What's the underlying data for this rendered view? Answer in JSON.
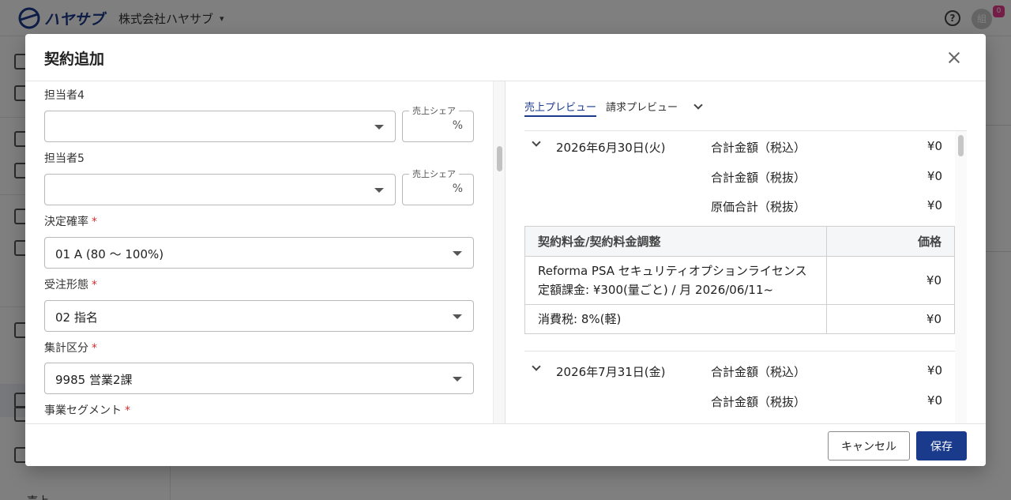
{
  "app": {
    "logo_text": "ハヤサブ",
    "company_name": "株式会社ハヤサブ",
    "avatar_initial": "組",
    "avatar_badge": "0",
    "sidebar_bottom_label": "売上"
  },
  "modal": {
    "title": "契約追加",
    "fields": {
      "staff4": {
        "label": "担当者4",
        "value": "",
        "share_legend": "売上シェア",
        "share_unit": "%"
      },
      "staff5": {
        "label": "担当者5",
        "value": "",
        "share_legend": "売上シェア",
        "share_unit": "%"
      },
      "probability": {
        "label": "決定確率",
        "required_mark": "*",
        "value": "01 A (80 〜 100%)"
      },
      "order_type": {
        "label": "受注形態",
        "required_mark": "*",
        "value": "02 指名"
      },
      "aggregation": {
        "label": "集計区分",
        "required_mark": "*",
        "value": "9985 営業2課"
      },
      "segment": {
        "label": "事業セグメント",
        "required_mark": "*"
      }
    },
    "preview": {
      "tabs": [
        "売上プレビュー",
        "請求プレビュー"
      ],
      "active_tab": 0,
      "months": [
        {
          "date": "2026年6月30日(火)",
          "totals": [
            {
              "label": "合計金額（税込）",
              "value": "¥0"
            },
            {
              "label": "合計金額（税抜）",
              "value": "¥0"
            },
            {
              "label": "原価合計（税抜）",
              "value": "¥0"
            }
          ],
          "table": {
            "headers": [
              "契約料金/契約料金調整",
              "価格"
            ],
            "rows": [
              {
                "item": "Reforma PSA セキュリティオプションライセンス 定額課金: ¥300(量ごと) / 月 2026/06/11~",
                "price": "¥0"
              },
              {
                "item": "消費税: 8%(軽)",
                "price": "¥0"
              }
            ]
          }
        },
        {
          "date": "2026年7月31日(金)",
          "totals": [
            {
              "label": "合計金額（税込）",
              "value": "¥0"
            },
            {
              "label": "合計金額（税抜）",
              "value": "¥0"
            }
          ]
        }
      ]
    },
    "footer": {
      "cancel_label": "キャンセル",
      "save_label": "保存"
    }
  },
  "colors": {
    "primary": "#1a3a8c",
    "required": "#d32f2f",
    "badge": "#e63b8f"
  }
}
